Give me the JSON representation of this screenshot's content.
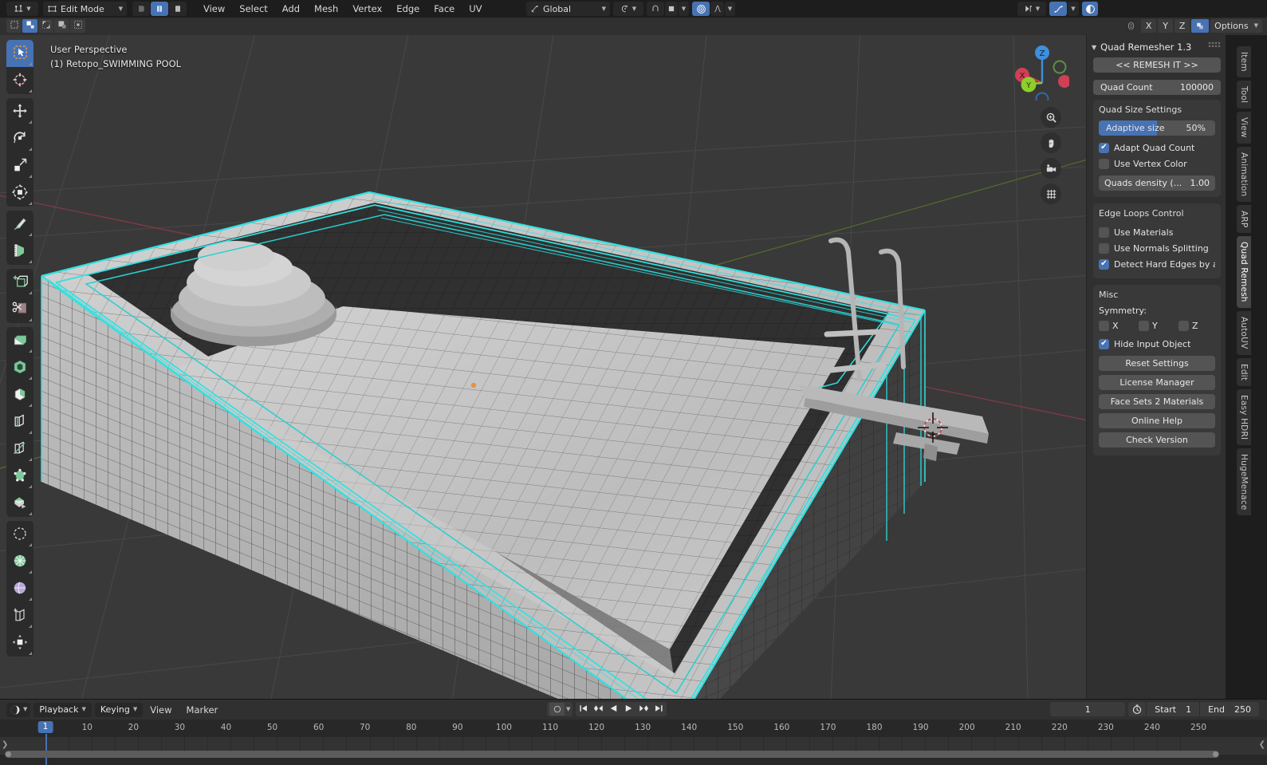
{
  "topbar": {
    "editor_type_icon": "editor-type-icon",
    "mode_selector": {
      "label": "Edit Mode",
      "icon": "edit-mode-icon"
    },
    "shading_modes": [
      "vertex-shading-icon",
      "edge-shading-icon",
      "face-shading-icon"
    ],
    "menus": [
      "View",
      "Select",
      "Add",
      "Mesh",
      "Vertex",
      "Edge",
      "Face",
      "UV"
    ],
    "transform_orientation": {
      "label": "Global",
      "icon": "orientation-icon"
    },
    "snap_icon": "magnet-snap-icon",
    "proportional_icon": "proportional-editing-icon",
    "falloff_icon": "falloff-curve-icon",
    "mirror_icon": "mirror-icon",
    "curve_icon": "curve-profile-icon"
  },
  "toolheader": {
    "select_modes": [
      "tweak-select-icon",
      "box-select-icon",
      "circle-select-icon",
      "lasso-select-icon",
      "select-all-icon"
    ],
    "active_select_mode_index": 1,
    "mesh_option_icon": "mesh-symmetry-icon",
    "axis_buttons": [
      "X",
      "Y",
      "Z"
    ],
    "mesh_edit_mode_icon": "mesh-edit-toggle-icon",
    "options_label": "Options"
  },
  "viewport": {
    "perspective_label": "User Perspective",
    "object_label": "(1) Retopo_SWIMMING POOL",
    "selection_color": "#2fe2e2",
    "grid_color": "#4a4a4a",
    "background_color": "#393939",
    "mesh_color": "#b4b4b4",
    "gizmo": {
      "axes": [
        {
          "label": "Z",
          "color": "#3e8fdd"
        },
        {
          "label": "X",
          "color": "#cf3f55"
        },
        {
          "label": "Y",
          "color": "#8ece2b"
        }
      ]
    },
    "nav_buttons": [
      "zoom-icon",
      "hand-pan-icon",
      "camera-view-icon",
      "ortho-persp-toggle-icon"
    ],
    "left_toolbar": [
      {
        "groups": [
          {
            "tools": [
              {
                "name": "tweak-tool",
                "icon": "cursor-arrow-icon",
                "active": true
              },
              {
                "name": "cursor-tool",
                "icon": "3d-cursor-icon",
                "active": false
              }
            ]
          },
          {
            "tools": [
              {
                "name": "move-tool",
                "icon": "move-arrows-icon",
                "active": false
              },
              {
                "name": "rotate-tool",
                "icon": "rotate-icon",
                "active": false
              },
              {
                "name": "scale-tool",
                "icon": "scale-icon",
                "active": false
              },
              {
                "name": "transform-tool",
                "icon": "transform-icon",
                "active": false
              }
            ]
          },
          {
            "tools": [
              {
                "name": "annotate-tool",
                "icon": "pencil-icon",
                "active": false
              },
              {
                "name": "measure-tool",
                "icon": "ruler-icon",
                "active": false
              }
            ]
          },
          {
            "tools": [
              {
                "name": "add-cube-tool",
                "icon": "add-cube-icon",
                "active": false
              },
              {
                "name": "rip-region-tool",
                "icon": "scissors-icon",
                "active": false
              }
            ]
          },
          {
            "tools": [
              {
                "name": "extrude-region-tool",
                "icon": "extrude-icon",
                "active": false
              },
              {
                "name": "inset-faces-tool",
                "icon": "inset-faces-icon",
                "active": false
              },
              {
                "name": "bevel-tool",
                "icon": "bevel-icon",
                "active": false
              },
              {
                "name": "loop-cut-tool",
                "icon": "loop-cut-icon",
                "active": false
              },
              {
                "name": "knife-tool",
                "icon": "knife-icon",
                "active": false
              },
              {
                "name": "poly-build-tool",
                "icon": "poly-build-icon",
                "active": false
              },
              {
                "name": "spin-tool",
                "icon": "spin-icon",
                "active": false
              }
            ]
          },
          {
            "tools": [
              {
                "name": "smooth-tool",
                "icon": "smooth-sphere-icon",
                "active": false
              },
              {
                "name": "edge-slide-tool",
                "icon": "edge-slide-icon",
                "active": false
              },
              {
                "name": "shrink-fatten-tool",
                "icon": "shrink-fatten-icon",
                "active": false
              },
              {
                "name": "shear-tool",
                "icon": "shear-icon",
                "active": false
              },
              {
                "name": "rip-tool",
                "icon": "rip-edge-icon",
                "active": false
              }
            ]
          }
        ]
      }
    ]
  },
  "side_panel": {
    "title": "Quad Remesher 1.3",
    "remesh_button": "<<  REMESH IT  >>",
    "quad_count": {
      "label": "Quad Count",
      "value": "100000"
    },
    "quad_size": {
      "title": "Quad Size Settings",
      "adaptive_size": {
        "label": "Adaptive size",
        "value": "50%",
        "percent": 50
      },
      "adapt_quad_count": {
        "label": "Adapt Quad Count",
        "checked": true
      },
      "use_vertex_color": {
        "label": "Use Vertex Color",
        "checked": false
      },
      "quads_density": {
        "label": "Quads density (...",
        "value": "1.00"
      }
    },
    "edge_loops": {
      "title": "Edge Loops Control",
      "use_materials": {
        "label": "Use Materials",
        "checked": false
      },
      "use_normals_splitting": {
        "label": "Use Normals Splitting",
        "checked": false
      },
      "detect_hard_edges": {
        "label": "Detect Hard Edges by a...",
        "checked": true
      }
    },
    "misc": {
      "title": "Misc",
      "symmetry_label": "Symmetry:",
      "symmetry": [
        {
          "label": "X",
          "checked": false
        },
        {
          "label": "Y",
          "checked": false
        },
        {
          "label": "Z",
          "checked": false
        }
      ],
      "hide_input_object": {
        "label": "Hide Input Object",
        "checked": true
      },
      "buttons": [
        "Reset Settings",
        "License Manager",
        "Face Sets 2 Materials",
        "Online Help",
        "Check Version"
      ]
    },
    "accent_color": "#4772b3"
  },
  "vertical_tabs": [
    {
      "label": "Item",
      "active": false
    },
    {
      "label": "Tool",
      "active": false
    },
    {
      "label": "View",
      "active": false
    },
    {
      "label": "Animation",
      "active": false
    },
    {
      "label": "ARP",
      "active": false
    },
    {
      "label": "Quad Remesh",
      "active": true
    },
    {
      "label": "AutoUV",
      "active": false
    },
    {
      "label": "Edit",
      "active": false
    },
    {
      "label": "Easy HDRI",
      "active": false
    },
    {
      "label": "HugeMenace",
      "active": false
    }
  ],
  "timeline": {
    "editor_icon": "timeline-editor-icon",
    "menus": [
      {
        "label": "Playback",
        "dropdown": true
      },
      {
        "label": "Keying",
        "dropdown": true
      },
      {
        "label": "View",
        "dropdown": false
      },
      {
        "label": "Marker",
        "dropdown": false
      }
    ],
    "snap_icon": "snap-keyframe-icon",
    "playback_buttons": [
      "jump-to-start-icon",
      "jump-to-prev-keyframe-icon",
      "play-reverse-icon",
      "play-icon",
      "jump-to-next-keyframe-icon",
      "jump-to-end-icon"
    ],
    "current_frame": "1",
    "timer_icon": "stopwatch-icon",
    "start": {
      "label": "Start",
      "value": "1"
    },
    "end": {
      "label": "End",
      "value": "250"
    },
    "ruler_ticks": [
      1,
      10,
      20,
      30,
      40,
      50,
      60,
      70,
      80,
      90,
      100,
      110,
      120,
      130,
      140,
      150,
      160,
      170,
      180,
      190,
      200,
      210,
      220,
      230,
      240,
      250
    ],
    "playhead_frame": 1,
    "accent_color": "#4772b3"
  }
}
